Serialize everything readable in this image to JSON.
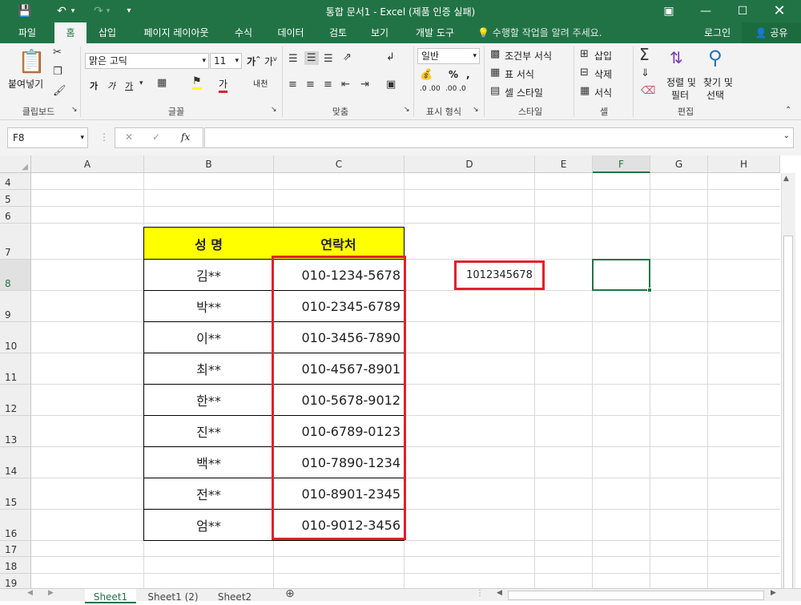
{
  "window": {
    "title": "통합 문서1 - Excel (제품 인증 실패)"
  },
  "tabs": [
    {
      "label": "파일",
      "active": false
    },
    {
      "label": "홈",
      "active": true
    },
    {
      "label": "삽입",
      "active": false
    },
    {
      "label": "페이지 레이아웃",
      "active": false
    },
    {
      "label": "수식",
      "active": false
    },
    {
      "label": "데이터",
      "active": false
    },
    {
      "label": "검토",
      "active": false
    },
    {
      "label": "보기",
      "active": false
    },
    {
      "label": "개발 도구",
      "active": false
    }
  ],
  "tell_me": "수행할 작업을 알려 주세요.",
  "login": "로그인",
  "share": "공유",
  "ribbon": {
    "clipboard": {
      "paste": "붙여넣기",
      "label": "클립보드"
    },
    "font": {
      "name": "맑은 고딕",
      "size": "11",
      "bold": "가",
      "italic": "가",
      "underline": "가",
      "label": "글꼴",
      "phonetic": "내천"
    },
    "align": {
      "label": "맞춤"
    },
    "number": {
      "format": "일반",
      "label": "표시 형식"
    },
    "styles": {
      "conditional": "조건부 서식",
      "table": "표 서식",
      "cell_style": "셀 스타일",
      "label": "스타일"
    },
    "cells": {
      "insert": "삽입",
      "delete": "삭제",
      "format": "서식",
      "label": "셀"
    },
    "editing": {
      "sort1": "정렬 및",
      "sort2": "필터",
      "find1": "찾기 및",
      "find2": "선택",
      "label": "편집"
    }
  },
  "formula_bar": {
    "name_box": "F8",
    "formula": ""
  },
  "columns": [
    "A",
    "B",
    "C",
    "D",
    "E",
    "F",
    "G",
    "H"
  ],
  "selected_column": "F",
  "rows": [
    "4",
    "5",
    "6",
    "7",
    "8",
    "9",
    "10",
    "11",
    "12",
    "13",
    "14",
    "15",
    "16",
    "17",
    "18",
    "19"
  ],
  "table": {
    "header_name": "성 명",
    "header_contact": "연락처",
    "records": [
      {
        "name": "김**",
        "phone": "010-1234-5678"
      },
      {
        "name": "박**",
        "phone": "010-2345-6789"
      },
      {
        "name": "이**",
        "phone": "010-3456-7890"
      },
      {
        "name": "최**",
        "phone": "010-4567-8901"
      },
      {
        "name": "한**",
        "phone": "010-5678-9012"
      },
      {
        "name": "진**",
        "phone": "010-6789-0123"
      },
      {
        "name": "백**",
        "phone": "010-7890-1234"
      },
      {
        "name": "전**",
        "phone": "010-8901-2345"
      },
      {
        "name": "엄**",
        "phone": "010-9012-3456"
      }
    ]
  },
  "d8_value": "1012345678",
  "sheets": [
    "Sheet1",
    "Sheet1 (2)",
    "Sheet2"
  ],
  "active_sheet": "Sheet1",
  "colors": {
    "excel_green": "#217346",
    "header_yellow": "#ffff00",
    "highlight_red": "#e0212b"
  }
}
